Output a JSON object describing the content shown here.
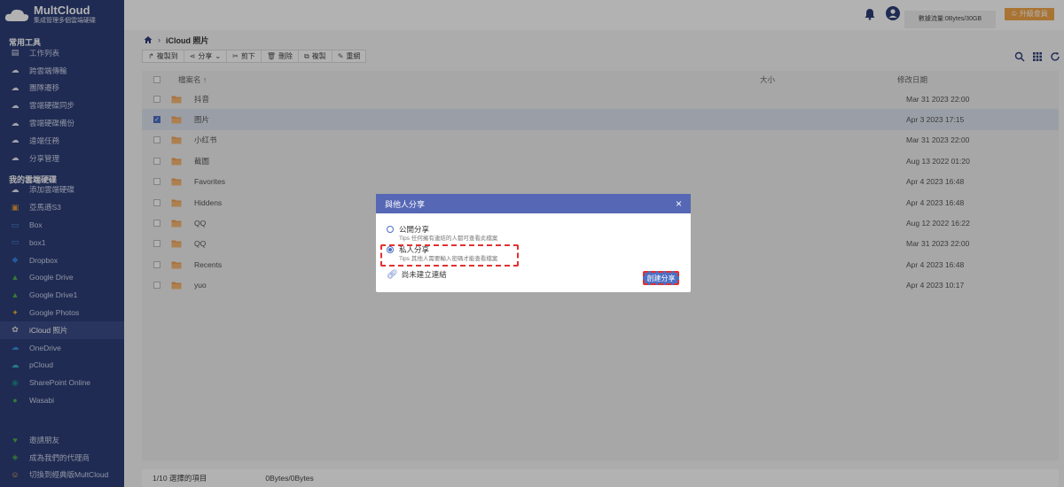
{
  "sidebar": {
    "brand_name": "MultCloud",
    "brand_tagline": "集成管理多個雲端硬碟",
    "section_tools": "常用工具",
    "tools": [
      {
        "label": "工作列表",
        "icon": "task-list-icon"
      },
      {
        "label": "跨雲端傳輸",
        "icon": "cloud-transfer-icon"
      },
      {
        "label": "團隊遷移",
        "icon": "team-migration-icon"
      },
      {
        "label": "雲端硬碟同步",
        "icon": "cloud-sync-icon"
      },
      {
        "label": "雲端硬碟備份",
        "icon": "cloud-backup-icon"
      },
      {
        "label": "遠端任務",
        "icon": "remote-upload-icon"
      },
      {
        "label": "分享管理",
        "icon": "share-manage-icon"
      }
    ],
    "section_drives": "我的雲端硬碟",
    "drives": [
      {
        "label": "添加雲端硬碟",
        "icon": "add-cloud-icon"
      },
      {
        "label": "亞馬遜S3",
        "icon": "amazon-s3-icon"
      },
      {
        "label": "Box",
        "icon": "box-icon"
      },
      {
        "label": "box1",
        "icon": "box-icon"
      },
      {
        "label": "Dropbox",
        "icon": "dropbox-icon"
      },
      {
        "label": "Google Drive",
        "icon": "google-drive-icon"
      },
      {
        "label": "Google Drive1",
        "icon": "google-drive-icon"
      },
      {
        "label": "Google Photos",
        "icon": "google-photos-icon"
      },
      {
        "label": "iCloud 照片",
        "icon": "icloud-photos-icon"
      },
      {
        "label": "OneDrive",
        "icon": "onedrive-icon"
      },
      {
        "label": "pCloud",
        "icon": "pcloud-icon"
      },
      {
        "label": "SharePoint Online",
        "icon": "sharepoint-icon"
      },
      {
        "label": "Wasabi",
        "icon": "wasabi-icon"
      }
    ],
    "bottom": [
      {
        "label": "邀請朋友",
        "icon": "invite-icon"
      },
      {
        "label": "成為我們的代理商",
        "icon": "affiliate-icon"
      },
      {
        "label": "切換到經典版MultCloud",
        "icon": "switch-classic-icon"
      }
    ]
  },
  "header": {
    "traffic": "數據流量:0Bytes/30GB",
    "upgrade": "升級會員"
  },
  "main": {
    "breadcrumb": "iCloud 照片",
    "toolbar": [
      {
        "label": "複製到",
        "icon": "copy-to-icon"
      },
      {
        "label": "分享",
        "icon": "share-icon"
      },
      {
        "label": "剪下",
        "icon": "cut-icon"
      },
      {
        "label": "刪除",
        "icon": "delete-icon"
      },
      {
        "label": "複製",
        "icon": "copy-icon"
      },
      {
        "label": "重網",
        "icon": "rename-icon"
      }
    ],
    "columns": {
      "name": "檔案名",
      "sort": "↑",
      "size": "大小",
      "date": "修改日期"
    },
    "rows": [
      {
        "name": "抖音",
        "size": "",
        "date": "Mar 31 2023 22:00",
        "checked": false
      },
      {
        "name": "图片",
        "size": "",
        "date": "Apr 3 2023 17:15",
        "checked": true
      },
      {
        "name": "小红书",
        "size": "",
        "date": "Mar 31 2023 22:00",
        "checked": false
      },
      {
        "name": "截圖",
        "size": "",
        "date": "Aug 13 2022 01:20",
        "checked": false
      },
      {
        "name": "Favorites",
        "size": "",
        "date": "Apr 4 2023 16:48",
        "checked": false
      },
      {
        "name": "Hiddens",
        "size": "",
        "date": "Apr 4 2023 16:48",
        "checked": false
      },
      {
        "name": "QQ",
        "size": "",
        "date": "Aug 12 2022 16:22",
        "checked": false
      },
      {
        "name": "QQ",
        "size": "",
        "date": "Mar 31 2023 22:00",
        "checked": false
      },
      {
        "name": "Recents",
        "size": "",
        "date": "Apr 4 2023 16:48",
        "checked": false
      },
      {
        "name": "yuo",
        "size": "",
        "date": "Apr 4 2023 10:17",
        "checked": false
      }
    ],
    "status_selected": "1/10 選擇的項目",
    "status_size": "0Bytes/0Bytes"
  },
  "dialog": {
    "title": "與他人分享",
    "public_label": "公開分享",
    "public_tip": "Tips 任何擁有連結的人都可查看此檔案",
    "private_label": "私人分享",
    "private_tip": "Tips 其他人需要輸入密碼才能查看檔案",
    "link_status": "尚未建立連結",
    "create_button": "創建分享",
    "selected_option": "private"
  },
  "colors": {
    "sidebar_bg": "#2d3e78",
    "dialog_header": "#5667b5",
    "accent": "#4e6fc4",
    "upgrade": "#f3a64a",
    "highlight": "#e23030"
  }
}
